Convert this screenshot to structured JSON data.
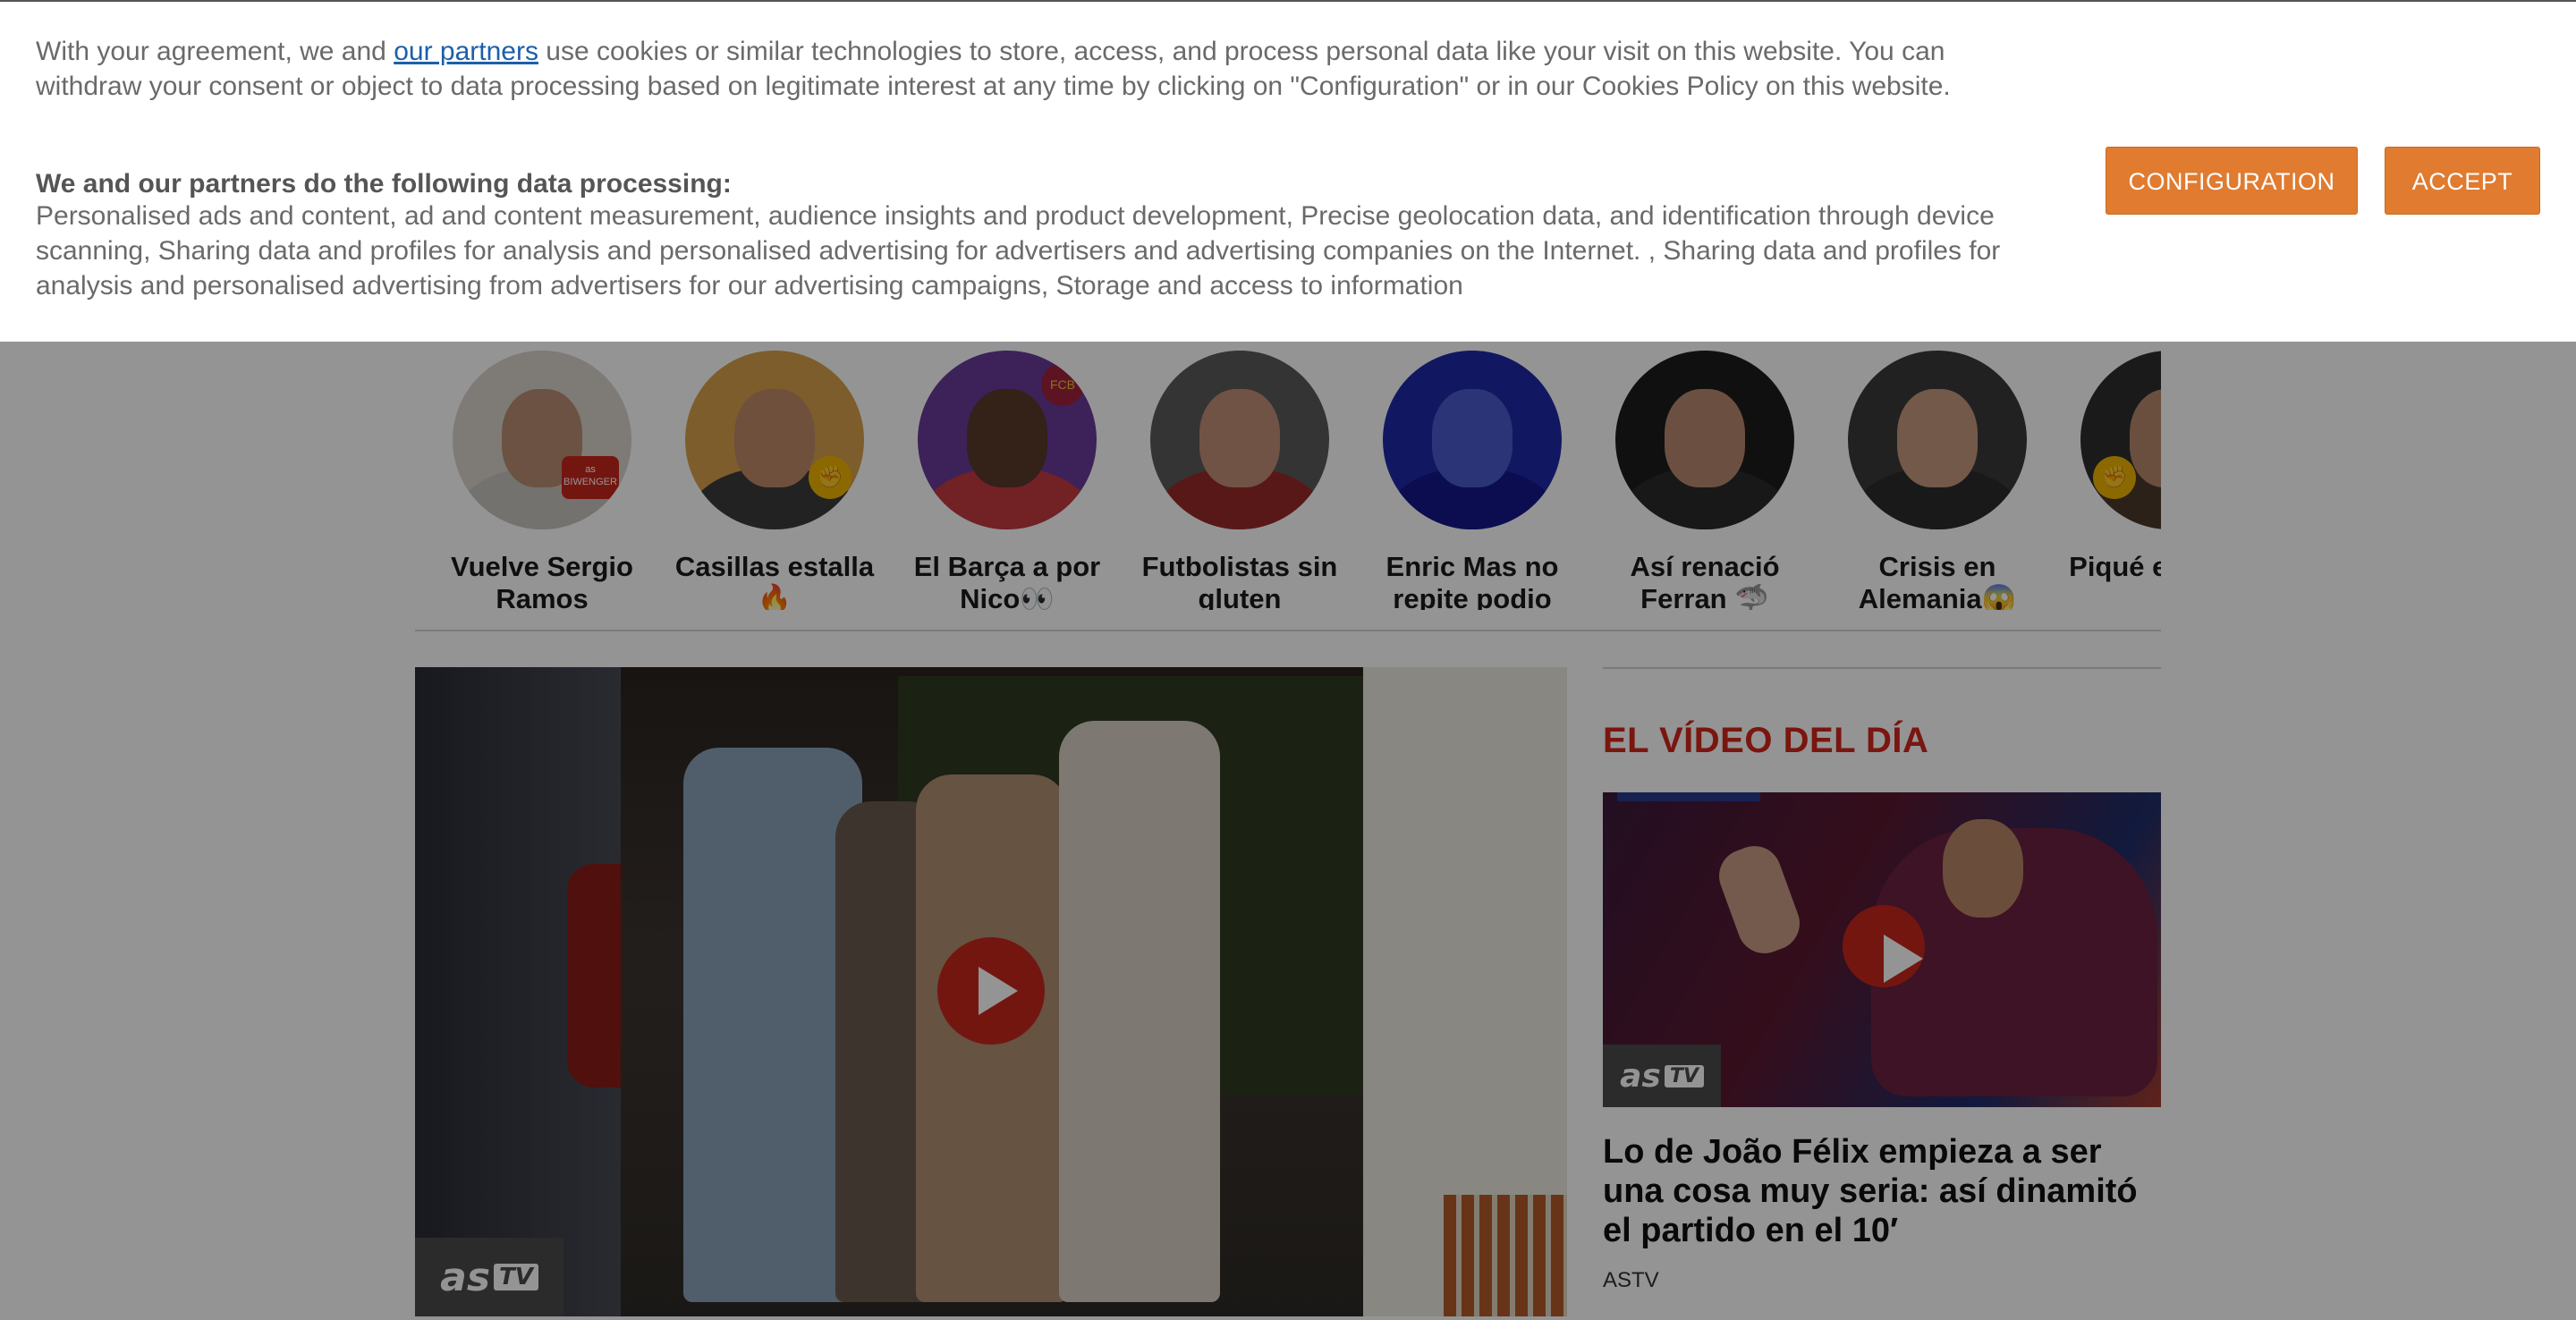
{
  "cookie_banner": {
    "intro_before_link": "With your agreement, we and ",
    "partners_link": "our partners",
    "intro_after_link": " use cookies or similar technologies to store, access, and process personal data like your visit on this website. You can withdraw your consent or object to data processing based on legitimate interest at any time by clicking on \"Configuration\" or in our Cookies Policy on this website.",
    "processing_heading": "We and our partners do the following data processing:",
    "processing_list": "Personalised ads and content, ad and content measurement, audience insights and product development, Precise geolocation data, and identification through device scanning, Sharing data and profiles for analysis and personalised advertising for advertisers and advertising companies on the Internet. , Sharing data and profiles for analysis and personalised advertising from advertisers for our advertising campaigns, Storage and access to information",
    "configuration_button": "Configuration",
    "accept_button": "Accept",
    "button_color": "#e07b30"
  },
  "stories": [
    {
      "label": "Vuelve Sergio Ramos",
      "badge": "as BIWENGER"
    },
    {
      "label": "Casillas estalla 🔥",
      "badge": "✊"
    },
    {
      "label": "El Barça a por Nico👀",
      "badge": "FCB"
    },
    {
      "label": "Futbolistas sin gluten",
      "badge": ""
    },
    {
      "label": "Enric Mas no repite podio",
      "badge": ""
    },
    {
      "label": "Así renació Ferran 🦈",
      "badge": ""
    },
    {
      "label": "Crisis en Alemania😱",
      "badge": ""
    },
    {
      "label": "Piqué está más",
      "badge": "✊"
    }
  ],
  "main_video": {
    "brand": "as",
    "brand_tv": "TV"
  },
  "sidebar": {
    "section_title": "EL VÍDEO DEL DÍA",
    "section_title_color": "#d2261b",
    "brand": "as",
    "brand_tv": "TV",
    "headline": "Lo de João Félix empieza a ser una cosa muy seria: así dinamitó el partido en el 10′",
    "source": "ASTV"
  }
}
